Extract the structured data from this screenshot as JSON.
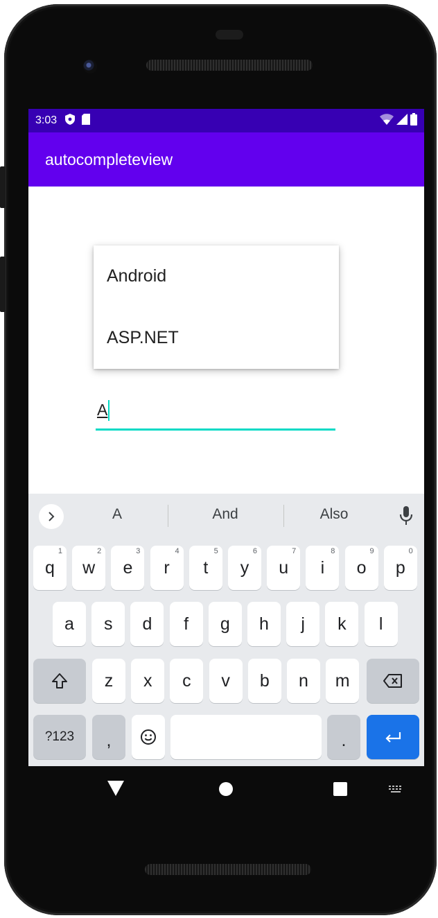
{
  "status_bar": {
    "time": "3:03"
  },
  "app_bar": {
    "title": "autocompleteview"
  },
  "dropdown": {
    "items": [
      "Android",
      "ASP.NET"
    ]
  },
  "input": {
    "value": "A"
  },
  "keyboard": {
    "suggestions": [
      "A",
      "And",
      "Also"
    ],
    "row1": [
      {
        "k": "q",
        "h": "1"
      },
      {
        "k": "w",
        "h": "2"
      },
      {
        "k": "e",
        "h": "3"
      },
      {
        "k": "r",
        "h": "4"
      },
      {
        "k": "t",
        "h": "5"
      },
      {
        "k": "y",
        "h": "6"
      },
      {
        "k": "u",
        "h": "7"
      },
      {
        "k": "i",
        "h": "8"
      },
      {
        "k": "o",
        "h": "9"
      },
      {
        "k": "p",
        "h": "0"
      }
    ],
    "row2": [
      "a",
      "s",
      "d",
      "f",
      "g",
      "h",
      "j",
      "k",
      "l"
    ],
    "row3": [
      "z",
      "x",
      "c",
      "v",
      "b",
      "n",
      "m"
    ],
    "symbols_label": "?123",
    "comma_label": ",",
    "period_label": "."
  },
  "colors": {
    "status_bar": "#3700b3",
    "app_bar": "#6200ee",
    "accent": "#03dac5",
    "enter_key": "#1a73e8"
  },
  "icons": {
    "status": [
      "shield-icon",
      "sd-card-icon",
      "wifi-icon",
      "signal-icon",
      "battery-icon"
    ],
    "navigation": [
      "back-triangle-icon",
      "home-circle-icon",
      "recents-square-icon",
      "keyboard-switch-icon"
    ]
  }
}
